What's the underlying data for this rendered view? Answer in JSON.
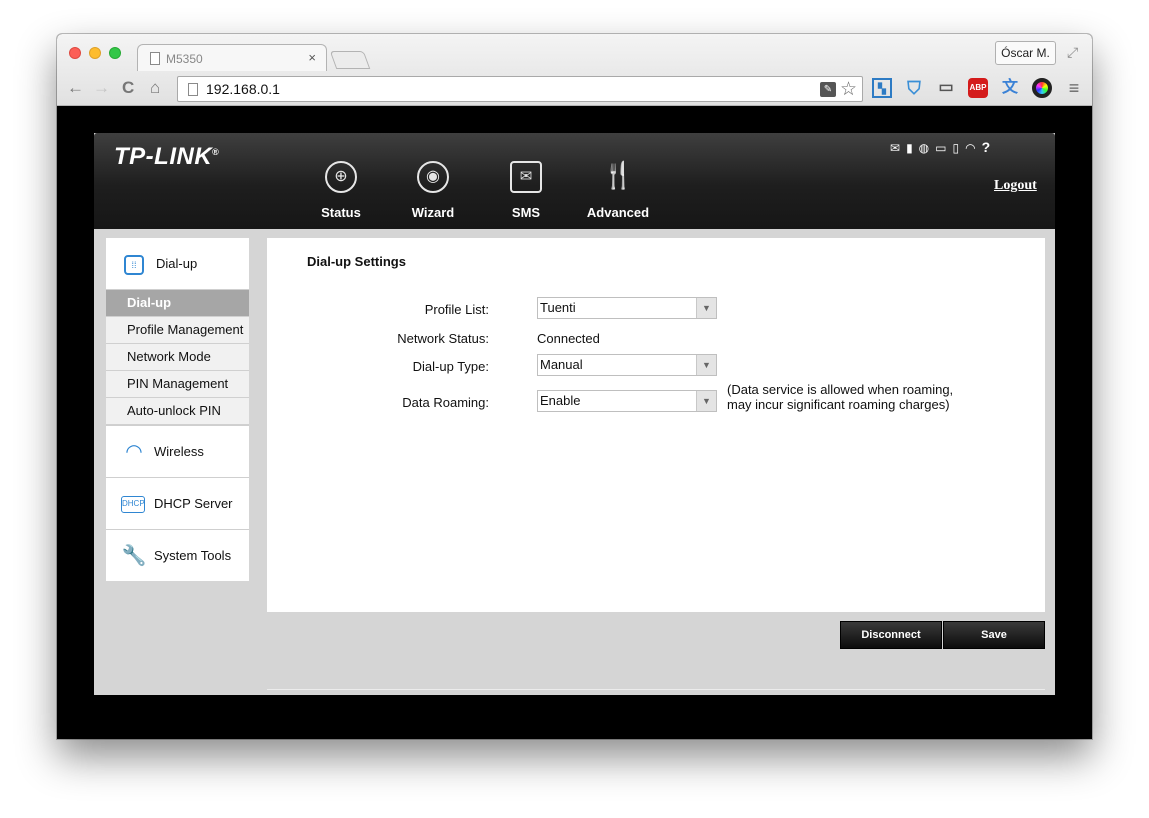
{
  "browser": {
    "tab_title": "M5350",
    "tab_close": "×",
    "user_button": "Óscar M.",
    "url": "192.168.0.1",
    "nav": {
      "back": "←",
      "forward": "→",
      "reload": "C",
      "home": "⌂"
    },
    "extensions": {
      "abp": "ABP",
      "menu": "≡"
    }
  },
  "router": {
    "logo": "TP-LINK",
    "logo_mark": "®",
    "logout": "Logout",
    "topnav": [
      {
        "label": "Status",
        "icon": "globe-icon"
      },
      {
        "label": "Wizard",
        "icon": "gear-icon"
      },
      {
        "label": "SMS",
        "icon": "envelope-icon"
      },
      {
        "label": "Advanced",
        "icon": "tools-icon"
      }
    ],
    "sidebar": {
      "header": "Dial-up",
      "items": [
        {
          "label": "Dial-up",
          "active": true
        },
        {
          "label": "Profile Management"
        },
        {
          "label": "Network Mode"
        },
        {
          "label": "PIN Management"
        },
        {
          "label": "Auto-unlock PIN"
        }
      ],
      "groups": [
        {
          "label": "Wireless",
          "icon": "wifi-icon"
        },
        {
          "label": "DHCP Server",
          "icon": "dhcp-icon",
          "icon_text": "DHCP"
        },
        {
          "label": "System Tools",
          "icon": "wrench-icon"
        }
      ]
    },
    "panel": {
      "title": "Dial-up Settings",
      "profile_list_label": "Profile List:",
      "profile_list_value": "Tuenti",
      "network_status_label": "Network Status:",
      "network_status_value": "Connected",
      "dialup_type_label": "Dial-up Type:",
      "dialup_type_value": "Manual",
      "data_roaming_label": "Data Roaming:",
      "data_roaming_value": "Enable",
      "roaming_note_line1": "(Data service is allowed when roaming,",
      "roaming_note_line2": "may incur significant roaming charges)"
    },
    "buttons": {
      "disconnect": "Disconnect",
      "save": "Save"
    },
    "status_bar": {
      "help": "?"
    }
  }
}
